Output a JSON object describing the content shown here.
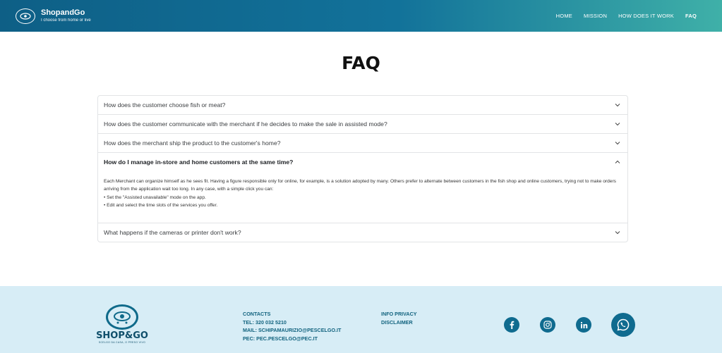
{
  "header": {
    "brand_name": "ShopandGo",
    "brand_tagline": "I choose from home or live",
    "nav": [
      "HOME",
      "MISSION",
      "HOW DOES IT WORK",
      "FAQ"
    ],
    "active_nav": "FAQ"
  },
  "page_title": "FAQ",
  "faq": {
    "items": [
      {
        "question": "How does the customer choose fish or meat?",
        "open": false
      },
      {
        "question": "How does the customer communicate with the merchant if he decides to make the sale in assisted mode?",
        "open": false
      },
      {
        "question": "How does the merchant ship the product to the customer's home?",
        "open": false
      },
      {
        "question": "How do I manage in-store and home customers at the same time?",
        "open": true,
        "answer_paragraph": "Each Merchant can organize himself as he sees fit. Having a figure responsible only for online, for example, is a solution adopted by many. Others prefer to alternate between customers in the fish shop and online customers, trying not to make orders arriving from the application wait too long. In any case, with a simple click you can:",
        "answer_bullets": [
          "• Set the \"Assisted unavailable\" mode on the app.",
          "• Edit and select the time slots of the services you offer."
        ]
      },
      {
        "question": "What happens if the cameras or printer don't work?",
        "open": false
      }
    ]
  },
  "footer": {
    "logo_word": "SHOP&GO",
    "logo_sub": "SCELGO DA CASA, O PRESO VIVO",
    "contacts": {
      "heading": "CONTACTS",
      "tel": "TEL: 320 032 5210",
      "mail": "MAIL: SCHIPAMAURIZIO@PESCELGO.IT",
      "pec": "PEC: PEC.PESCELGO@PEC.IT"
    },
    "legal": {
      "privacy": "INFO PRIVACY",
      "disclaimer": "DISCLAIMER"
    },
    "social": [
      "facebook-icon",
      "instagram-icon",
      "linkedin-icon",
      "whatsapp-icon"
    ]
  },
  "colors": {
    "header_start": "#0e5f86",
    "header_end": "#3fb0a8",
    "footer_bg": "#d7edf6",
    "accent": "#0f6b8f"
  }
}
